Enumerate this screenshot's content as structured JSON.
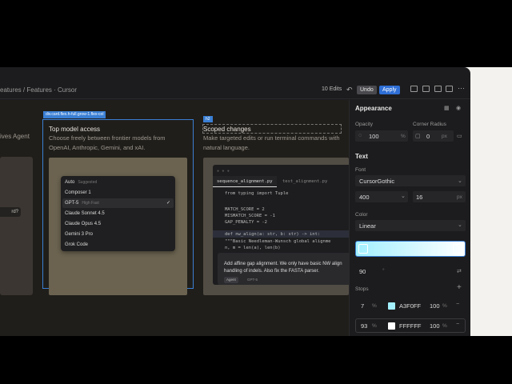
{
  "topbar": {
    "breadcrumb": "eatures / Features · Cursor",
    "edits": "10 Edits",
    "undo_label": "Undo",
    "apply_label": "Apply"
  },
  "canvas": {
    "left_fragment": "ives Agent",
    "left_pill": "rd?",
    "selection_tag": "div.card.flex.h-full.grow-1.flex-col",
    "card1": {
      "title": "Top model access",
      "desc": "Choose freely between frontier models from OpenAI, Anthropic, Gemini, and xAI."
    },
    "model_menu": [
      {
        "label": "Auto",
        "sub": "Suggested"
      },
      {
        "label": "Composer 1",
        "sub": ""
      },
      {
        "label": "GPT-5",
        "sub": "High Fast",
        "selected": true
      },
      {
        "label": "Claude Sonnet 4.5",
        "sub": ""
      },
      {
        "label": "Claude Opus 4.5",
        "sub": ""
      },
      {
        "label": "Gemini 3 Pro",
        "sub": ""
      },
      {
        "label": "Grok Code",
        "sub": ""
      }
    ],
    "h2_tag": "h2",
    "card2": {
      "title": "Scoped changes",
      "desc": "Make targeted edits or run terminal commands with natural language."
    },
    "editor": {
      "tabs": [
        "sequence_alignment.py",
        "test_alignment.py"
      ],
      "lines": [
        "from typing import Tuple",
        "",
        "MATCH_SCORE = 2",
        "MISMATCH_SCORE = -1",
        "GAP_PENALTY = -2",
        "",
        "def nw_align(a: str, b: str) -> int:",
        "    \"\"\"Basic Needleman-Wunsch global alignme",
        "    n, m = len(a), len(b)"
      ],
      "agent_prompt": "Add affine gap alignment. We only have basic NW align handling of indels. Also fix the FASTA parser.",
      "agent_label": "Agent",
      "agent_model": "GPT-5"
    }
  },
  "panel": {
    "appearance_title": "Appearance",
    "opacity_label": "Opacity",
    "opacity_value": "100",
    "opacity_unit": "%",
    "radius_label": "Corner Radius",
    "radius_value": "0",
    "radius_unit": "px",
    "text_title": "Text",
    "font_label": "Font",
    "font_value": "CursorGothic",
    "weight_value": "400",
    "size_value": "16",
    "size_unit": "px",
    "color_label": "Color",
    "color_mode": "Linear",
    "angle_value": "90",
    "angle_unit": "°",
    "stops_label": "Stops",
    "stops": [
      {
        "pos": "7",
        "unit": "%",
        "hex": "A3F0FF",
        "opacity": "100",
        "color": "#A3F0FF"
      },
      {
        "pos": "93",
        "unit": "%",
        "hex": "FFFFFF",
        "opacity": "100",
        "color": "#FFFFFF"
      }
    ]
  }
}
